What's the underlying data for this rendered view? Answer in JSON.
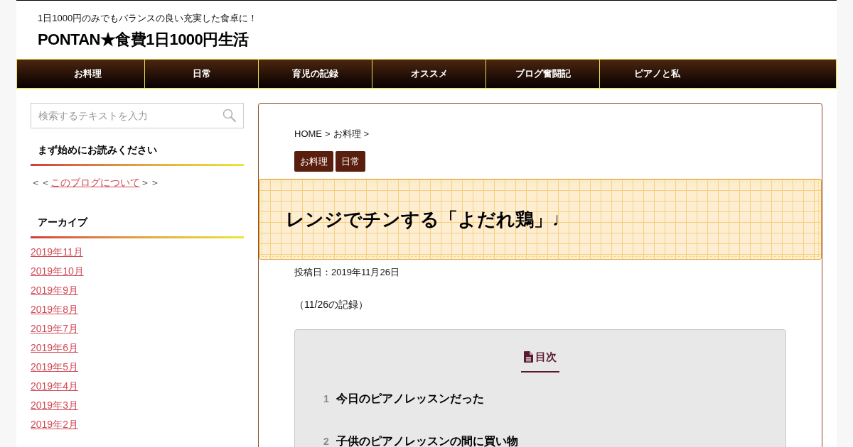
{
  "header": {
    "tagline": "1日1000円のみでもバランスの良い充実した食卓に！",
    "site_title": "PONTAN★食費1日1000円生活"
  },
  "nav": [
    {
      "label": "お料理"
    },
    {
      "label": "日常"
    },
    {
      "label": "育児の記録"
    },
    {
      "label": "オススメ"
    },
    {
      "label": "ブログ奮闘記"
    },
    {
      "label": "ピアノと私"
    }
  ],
  "sidebar": {
    "search": {
      "placeholder": "検索するテキストを入力"
    },
    "widgets": [
      {
        "kind": "text",
        "title": "まず始めにお読みください",
        "before": "＜＜",
        "link": "このブログについて",
        "after": "＞＞"
      },
      {
        "kind": "links",
        "title": "アーカイブ",
        "links": [
          "2019年11月",
          "2019年10月",
          "2019年9月",
          "2019年8月",
          "2019年7月",
          "2019年6月",
          "2019年5月",
          "2019年4月",
          "2019年3月",
          "2019年2月"
        ]
      }
    ]
  },
  "article": {
    "breadcrumb": [
      {
        "kind": "link",
        "label": "HOME"
      },
      {
        "kind": "separator",
        "label": ">"
      },
      {
        "kind": "link",
        "label": "お料理"
      },
      {
        "kind": "separator",
        "label": ">"
      }
    ],
    "tags": [
      "お料理",
      "日常"
    ],
    "title": "レンジでチンする「よだれ鶏」♩",
    "date": "投稿日：2019年11月26日",
    "intro": "（11/26の記録）",
    "toc": {
      "title": "目次",
      "items": [
        {
          "number": "1",
          "label": "今日のピアノレッスンだった"
        },
        {
          "number": "2",
          "label": "子供のピアノレッスンの間に買い物"
        }
      ]
    }
  }
}
